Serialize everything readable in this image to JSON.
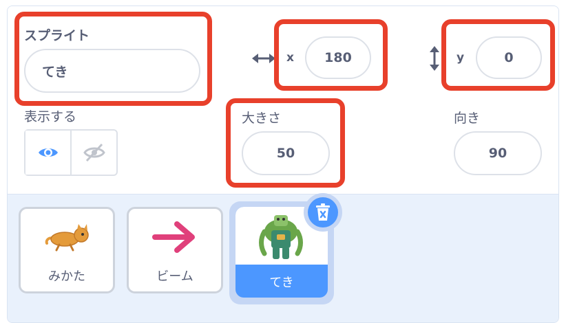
{
  "sprite_info": {
    "sprite_label": "スプライト",
    "sprite_name": "てき",
    "x_label": "x",
    "x_value": "180",
    "y_label": "y",
    "y_value": "0",
    "show_label": "表示する",
    "size_label": "大きさ",
    "size_value": "50",
    "direction_label": "向き",
    "direction_value": "90"
  },
  "sprites": [
    {
      "name": "みかた",
      "icon": "cat-icon"
    },
    {
      "name": "ビーム",
      "icon": "arrow-right-icon"
    },
    {
      "name": "てき",
      "icon": "monster-icon",
      "selected": true
    }
  ],
  "colors": {
    "highlight": "#e8402b",
    "accent": "#4c97ff",
    "text": "#575e75",
    "tray_bg": "#e9f1fc"
  }
}
